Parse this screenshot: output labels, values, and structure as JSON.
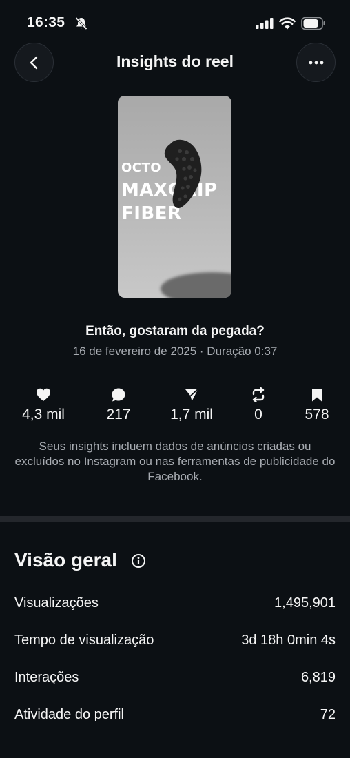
{
  "status_bar": {
    "time": "16:35",
    "icons": [
      "bell-slash-icon",
      "cellular-signal-icon",
      "wifi-icon",
      "battery-icon"
    ]
  },
  "header": {
    "title": "Insights do reel",
    "back_icon": "chevron-left-icon",
    "more_icon": "more-horizontal-icon"
  },
  "reel": {
    "thumbnail_text": [
      "OCTO",
      "MAXGRIP",
      "FIBER"
    ],
    "caption": "Então, gostaram da pegada?",
    "meta": "16 de fevereiro de 2025 · Duração 0:37"
  },
  "stats": [
    {
      "icon": "heart-icon",
      "value": "4,3 mil"
    },
    {
      "icon": "comment-icon",
      "value": "217"
    },
    {
      "icon": "share-icon",
      "value": "1,7 mil"
    },
    {
      "icon": "repost-icon",
      "value": "0"
    },
    {
      "icon": "bookmark-icon",
      "value": "578"
    }
  ],
  "notice": "Seus insights incluem dados de anúncios criadas ou excluídos no Instagram ou nas ferramentas de publicidade do Facebook.",
  "overview": {
    "title": "Visão geral",
    "info_icon": "info-icon",
    "rows": [
      {
        "label": "Visualizações",
        "value": "1,495,901"
      },
      {
        "label": "Tempo de visualização",
        "value": "3d 18h 0min 4s"
      },
      {
        "label": "Interações",
        "value": "6,819"
      },
      {
        "label": "Atividade do perfil",
        "value": "72"
      }
    ]
  },
  "colors": {
    "background": "#0c1014",
    "text": "#f5f5f5",
    "secondary_text": "#a8acb2",
    "divider": "#24272c"
  }
}
